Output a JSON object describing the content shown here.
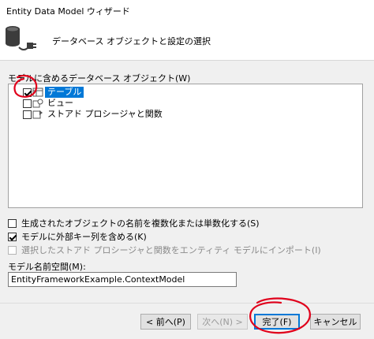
{
  "window": {
    "title": "Entity Data Model ウィザード"
  },
  "header": {
    "heading": "データベース オブジェクトと設定の選択",
    "icon": "database-connection-icon"
  },
  "objects": {
    "label": "モデルに含めるデータベース オブジェクト(W)",
    "items": [
      {
        "label": "テーブル",
        "checked": true,
        "selected": true,
        "icon": "table-icon"
      },
      {
        "label": "ビュー",
        "checked": false,
        "icon": "view-icon"
      },
      {
        "label": "ストアド プロシージャと関数",
        "checked": false,
        "icon": "stored-procedure-icon"
      }
    ]
  },
  "options": {
    "pluralize": {
      "label": "生成されたオブジェクトの名前を複数化または単数化する(S)",
      "checked": false
    },
    "foreign_keys": {
      "label": "モデルに外部キー列を含める(K)",
      "checked": true
    },
    "import_procs": {
      "label": "選択したストアド プロシージャと関数をエンティティ モデルにインポート(I)",
      "checked": false,
      "disabled": true
    }
  },
  "namespace": {
    "label": "モデル名前空間(M):",
    "value": "EntityFrameworkExample.ContextModel"
  },
  "buttons": {
    "prev": "< 前へ(P)",
    "next": "次へ(N) >",
    "finish": "完了(F)",
    "cancel": "キャンセル"
  },
  "colors": {
    "accent": "#0078d7",
    "annotation": "#e0001b"
  }
}
